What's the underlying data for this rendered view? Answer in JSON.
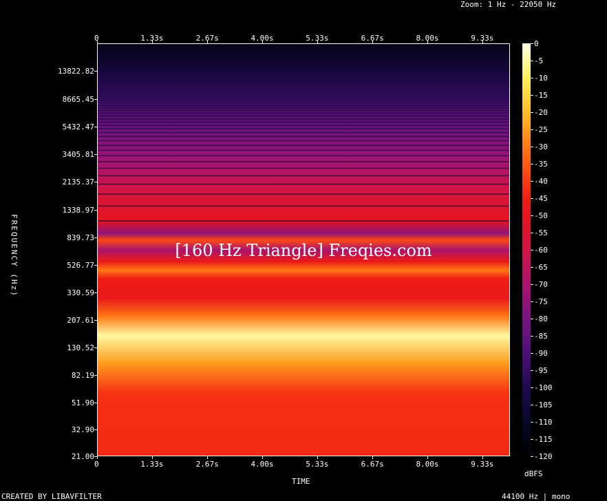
{
  "header": {
    "zoom_text": "Zoom: 1 Hz - 22050 Hz"
  },
  "footer": {
    "left": "CREATED BY LIBAVFILTER",
    "right": "44100 Hz | mono"
  },
  "watermark": "[160 Hz Triangle] Freqies.com",
  "colors": {
    "background": "#000000",
    "axis": "#ffffff"
  },
  "chart_data": {
    "type": "heatmap",
    "title": "",
    "xlabel": "TIME",
    "ylabel": "FREQUENCY (Hz)",
    "colorbar_label": "dBFS",
    "x_ticks": [
      "0",
      "1.33s",
      "2.67s",
      "4.00s",
      "5.33s",
      "6.67s",
      "8.00s",
      "9.33s"
    ],
    "x_tick_values": [
      0,
      1.33,
      2.67,
      4.0,
      5.33,
      6.67,
      8.0,
      9.33
    ],
    "xlim": [
      0,
      10
    ],
    "y_ticks": [
      "21.00",
      "32.90",
      "51.90",
      "82.19",
      "130.52",
      "207.61",
      "330.59",
      "526.77",
      "839.73",
      "1338.97",
      "2135.37",
      "3405.81",
      "5432.47",
      "8665.45",
      "13822.82"
    ],
    "y_tick_values": [
      21.0,
      32.9,
      51.9,
      82.19,
      130.52,
      207.61,
      330.59,
      526.77,
      839.73,
      1338.97,
      2135.37,
      3405.81,
      5432.47,
      8665.45,
      13822.82
    ],
    "y_scale": "log",
    "ylim": [
      21,
      22050
    ],
    "colorbar_ticks": [
      "0",
      "-5",
      "-10",
      "-15",
      "-20",
      "-25",
      "-30",
      "-35",
      "-40",
      "-45",
      "-50",
      "-55",
      "-60",
      "-65",
      "-70",
      "-75",
      "-80",
      "-85",
      "-90",
      "-95",
      "-100",
      "-105",
      "-110",
      "-115",
      "-120"
    ],
    "colorbar_range": [
      -120,
      0
    ],
    "frequency_profile_dbfs": [
      {
        "hz": 21,
        "db": -43
      },
      {
        "hz": 60,
        "db": -42
      },
      {
        "hz": 100,
        "db": -25
      },
      {
        "hz": 160,
        "db": -5
      },
      {
        "hz": 220,
        "db": -30
      },
      {
        "hz": 300,
        "db": -48
      },
      {
        "hz": 420,
        "db": -45
      },
      {
        "hz": 480,
        "db": -30
      },
      {
        "hz": 560,
        "db": -48
      },
      {
        "hz": 680,
        "db": -70
      },
      {
        "hz": 800,
        "db": -38
      },
      {
        "hz": 900,
        "db": -75
      },
      {
        "hz": 1120,
        "db": -50
      },
      {
        "hz": 1440,
        "db": -55
      },
      {
        "hz": 1760,
        "db": -58
      },
      {
        "hz": 2080,
        "db": -62
      },
      {
        "hz": 3000,
        "db": -72
      },
      {
        "hz": 5000,
        "db": -82
      },
      {
        "hz": 9000,
        "db": -95
      },
      {
        "hz": 15000,
        "db": -105
      },
      {
        "hz": 22050,
        "db": -115
      }
    ]
  }
}
